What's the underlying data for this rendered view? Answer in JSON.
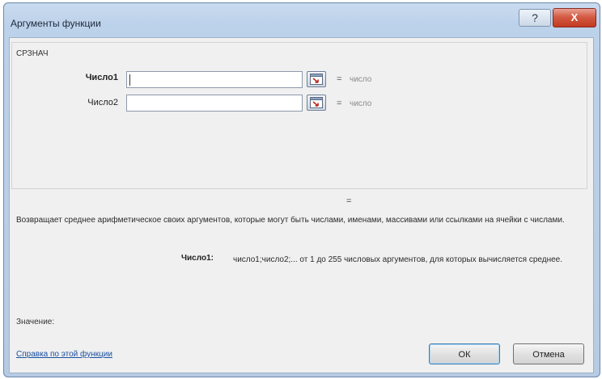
{
  "window": {
    "title": "Аргументы функции",
    "help_glyph": "?",
    "close_glyph": "X"
  },
  "function_name": "СРЗНАЧ",
  "args": [
    {
      "label": "Число1",
      "value": "",
      "equals": "=",
      "hint": "число"
    },
    {
      "label": "Число2",
      "value": "",
      "equals": "=",
      "hint": "число"
    }
  ],
  "result_equals": "=",
  "description": "Возвращает среднее арифметическое своих аргументов, которые могут быть числами, именами, массивами или ссылками на ячейки с числами.",
  "arg_description": {
    "label": "Число1:",
    "text": "число1;число2;... от 1 до 255 числовых аргументов, для которых вычисляется среднее."
  },
  "value_label": "Значение:",
  "help_link": "Справка по этой функции",
  "buttons": {
    "ok": "ОК",
    "cancel": "Отмена"
  },
  "icons": {
    "ref_button": "collapse-dialog-icon"
  }
}
